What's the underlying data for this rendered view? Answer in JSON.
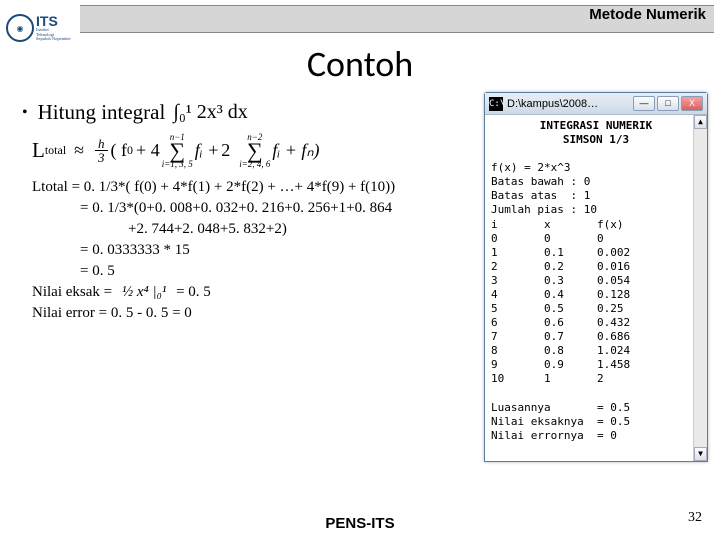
{
  "header": {
    "course": "Metode Numerik"
  },
  "logo": {
    "name": "ITS",
    "institute": "Institut",
    "line2": "Teknologi",
    "line3": "Sepuluh Nopember"
  },
  "title": "Contoh",
  "bullet": "Hitung integral",
  "integral": "∫₀¹ 2x³ dx",
  "formula": {
    "L": "L",
    "sub": "total",
    "approx": "≈",
    "h": "h",
    "three": "3",
    "open": "( f",
    "zero": "0",
    "plus4": "+ 4",
    "s1_top": "n−1",
    "s1_bot": "i=1, 3, 5",
    "fi": "fᵢ +",
    "two": "2",
    "s2_top": "n−2",
    "s2_bot": "i=2, 4, 6",
    "fi2": "fᵢ + fₙ)"
  },
  "calc": {
    "l1": "Ltotal = 0. 1/3*( f(0) + 4*f(1) + 2*f(2) + …+ 4*f(9) + f(10))",
    "l2": "= 0. 1/3*(0+0. 008+0. 032+0. 216+0. 256+1+0. 864",
    "l3": "+2. 744+2. 048+5. 832+2)",
    "l4": "= 0. 0333333 * 15",
    "l5": "= 0. 5",
    "l6a": "Nilai eksak =",
    "l6img": "½ x⁴ |₀¹",
    "l6b": "=  0. 5",
    "l7": "Nilai error = 0. 5 - 0. 5 = 0"
  },
  "console": {
    "title": "D:\\kampus\\2008…",
    "head1": "INTEGRASI NUMERIK",
    "head2": "SIMSON 1/3",
    "fx": "f(x) = 2*x^3",
    "bb": "Batas bawah : 0",
    "ba": "Batas atas  : 1",
    "jp": "Jumlah pias : 10",
    "cols": "i       x       f(x)",
    "rows": [
      "0       0       0",
      "1       0.1     0.002",
      "2       0.2     0.016",
      "3       0.3     0.054",
      "4       0.4     0.128",
      "5       0.5     0.25",
      "6       0.6     0.432",
      "7       0.7     0.686",
      "8       0.8     1.024",
      "9       0.9     1.458",
      "10      1       2"
    ],
    "luas": "Luasannya       = 0.5",
    "eksak": "Nilai eksaknya  = 0.5",
    "error": "Nilai errornya  = 0"
  },
  "footer": "PENS-ITS",
  "page": "32",
  "btn": {
    "min": "—",
    "max": "□",
    "close": "X",
    "up": "▲",
    "down": "▼"
  }
}
